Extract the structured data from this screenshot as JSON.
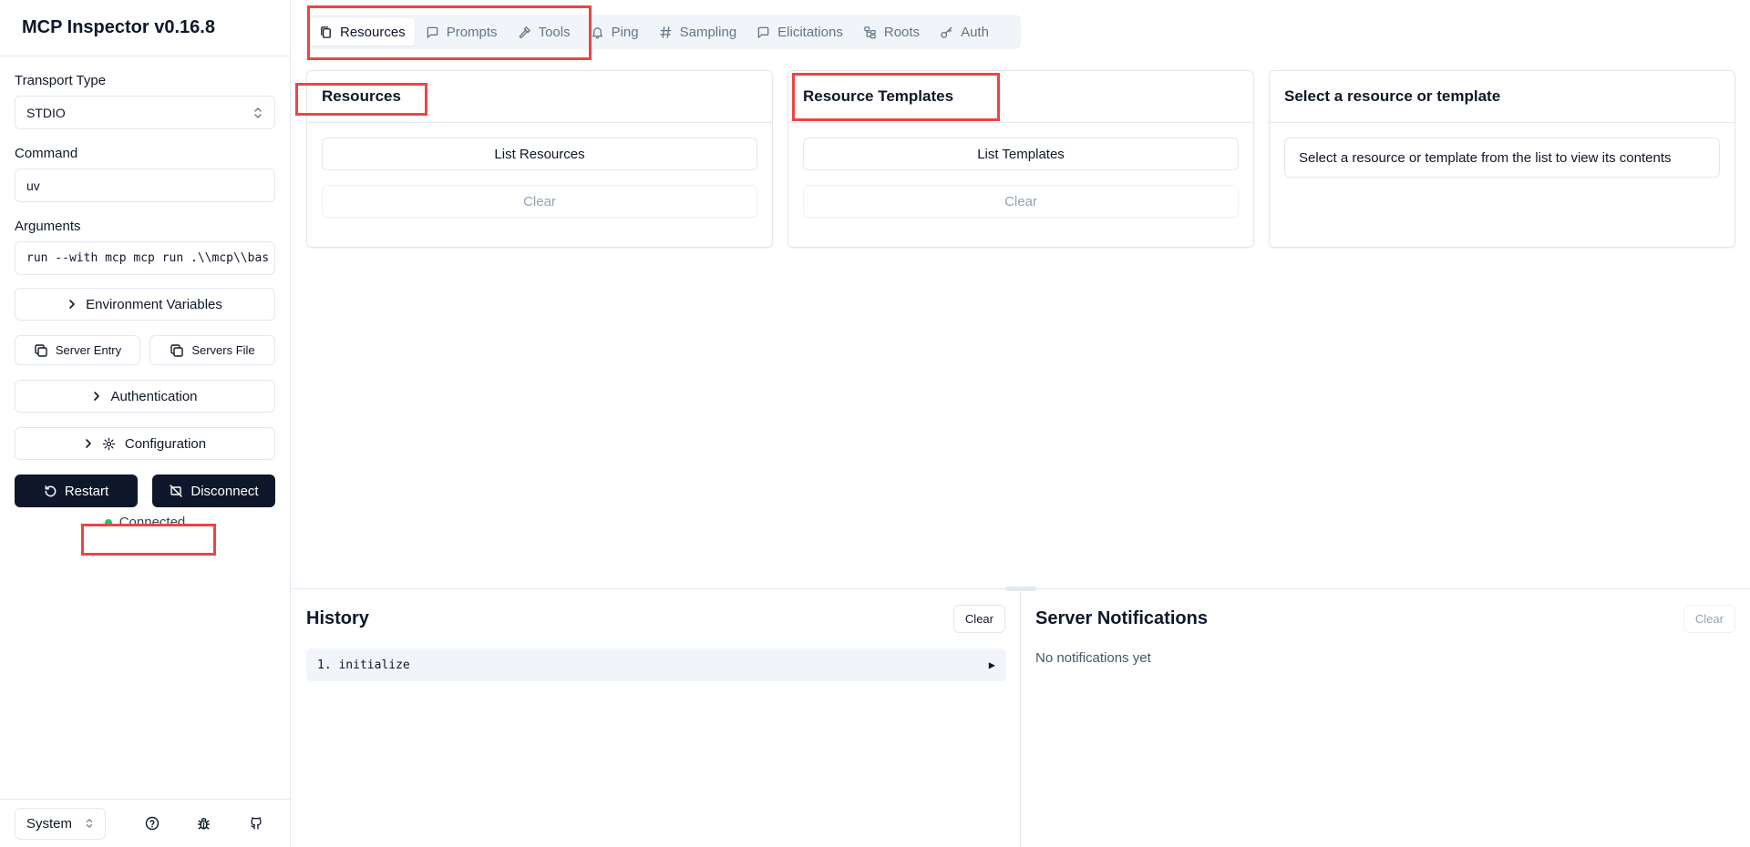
{
  "app": {
    "title": "MCP Inspector v0.16.8"
  },
  "sidebar": {
    "transport_label": "Transport Type",
    "transport_value": "STDIO",
    "command_label": "Command",
    "command_value": "uv",
    "arguments_label": "Arguments",
    "arguments_value": "run --with mcp mcp run .\\\\mcp\\\\bas",
    "env_button": "Environment Variables",
    "server_entry_button": "Server Entry",
    "servers_file_button": "Servers File",
    "auth_button": "Authentication",
    "config_button": "Configuration",
    "restart_button": "Restart",
    "disconnect_button": "Disconnect",
    "status_text": "Connected",
    "status_color": "#22c55e",
    "theme_value": "System"
  },
  "tabs": [
    {
      "label": "Resources",
      "icon": "files-icon",
      "active": true
    },
    {
      "label": "Prompts",
      "icon": "message-icon",
      "active": false
    },
    {
      "label": "Tools",
      "icon": "hammer-icon",
      "active": false
    },
    {
      "label": "Ping",
      "icon": "bell-icon",
      "active": false
    },
    {
      "label": "Sampling",
      "icon": "hash-icon",
      "active": false
    },
    {
      "label": "Elicitations",
      "icon": "message-icon",
      "active": false
    },
    {
      "label": "Roots",
      "icon": "folder-tree-icon",
      "active": false
    },
    {
      "label": "Auth",
      "icon": "key-icon",
      "active": false
    }
  ],
  "resources_card": {
    "title": "Resources",
    "list_button": "List Resources",
    "clear_button": "Clear"
  },
  "templates_card": {
    "title": "Resource Templates",
    "list_button": "List Templates",
    "clear_button": "Clear"
  },
  "detail_card": {
    "title": "Select a resource or template",
    "message": "Select a resource or template from the list to view its contents"
  },
  "history": {
    "title": "History",
    "clear_button": "Clear",
    "items": [
      "1. initialize"
    ],
    "expand_glyph": "▶"
  },
  "notifications": {
    "title": "Server Notifications",
    "clear_button": "Clear",
    "empty_text": "No notifications yet"
  },
  "colors": {
    "highlight": "#ef4444",
    "primary_dark": "#0f172a",
    "border": "#e2e8f0",
    "tab_bg": "#f1f5f9"
  }
}
